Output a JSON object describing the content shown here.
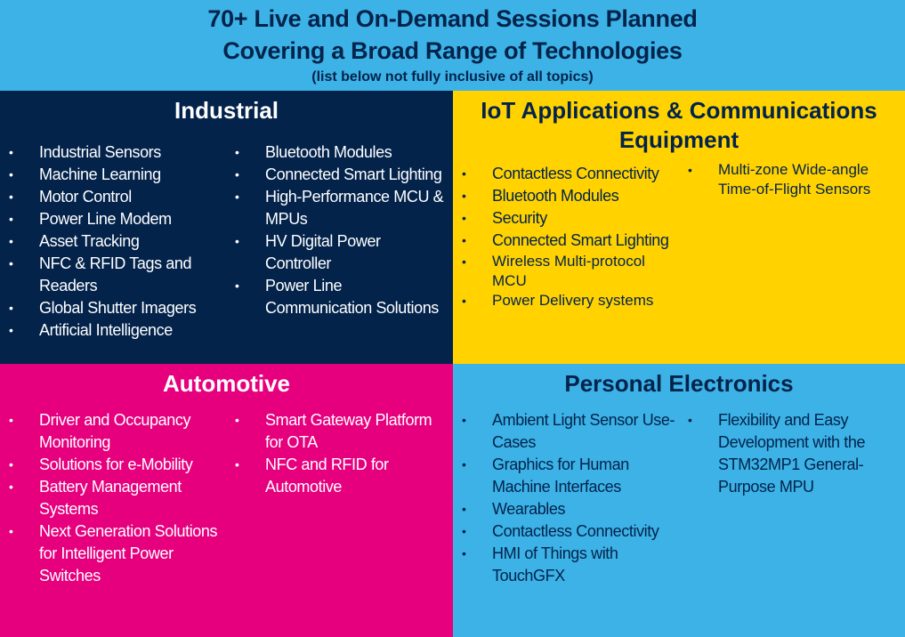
{
  "header": {
    "line1": "70+ Live and On-Demand Sessions Planned",
    "line2": "Covering a Broad Range of Technologies",
    "note": "(list below not fully inclusive of all topics)"
  },
  "colors": {
    "light_blue": "#3cb2e6",
    "dark_navy": "#03234b",
    "yellow": "#ffd200",
    "magenta": "#e6007e",
    "white": "#ffffff"
  },
  "bullet": "•",
  "industrial": {
    "title": "Industrial",
    "col1": [
      "Industrial Sensors",
      "Machine Learning",
      "Motor Control",
      "Power Line Modem",
      "Asset Tracking",
      "NFC & RFID Tags and Readers",
      "Global Shutter Imagers",
      "Artificial Intelligence"
    ],
    "col2": [
      "Bluetooth Modules",
      "Connected Smart Lighting",
      "High-Performance MCU & MPUs",
      "HV Digital Power Controller",
      "Power Line Communication Solutions"
    ]
  },
  "iot": {
    "title": "IoT Applications & Communications Equipment",
    "col1": [
      "Contactless Connectivity",
      "Bluetooth Modules",
      "Security",
      "Connected Smart Lighting",
      "Wireless Multi-protocol MCU",
      "Power Delivery systems"
    ],
    "col2": [
      "Multi-zone Wide-angle Time-of-Flight Sensors"
    ]
  },
  "automotive": {
    "title": "Automotive",
    "col1": [
      "Driver and Occupancy Monitoring",
      "Solutions for e-Mobility",
      "Battery Management Systems",
      "Next Generation Solutions for Intelligent Power Switches"
    ],
    "col2": [
      "Smart Gateway Platform for OTA",
      "NFC and RFID for Automotive"
    ]
  },
  "personal": {
    "title": "Personal Electronics",
    "col1": [
      "Ambient Light Sensor Use-Cases",
      "Graphics for Human Machine Interfaces",
      "Wearables",
      "Contactless Connectivity",
      "HMI of Things with TouchGFX"
    ],
    "col2": [
      "Flexibility and Easy Development with the STM32MP1 General-Purpose MPU"
    ]
  }
}
